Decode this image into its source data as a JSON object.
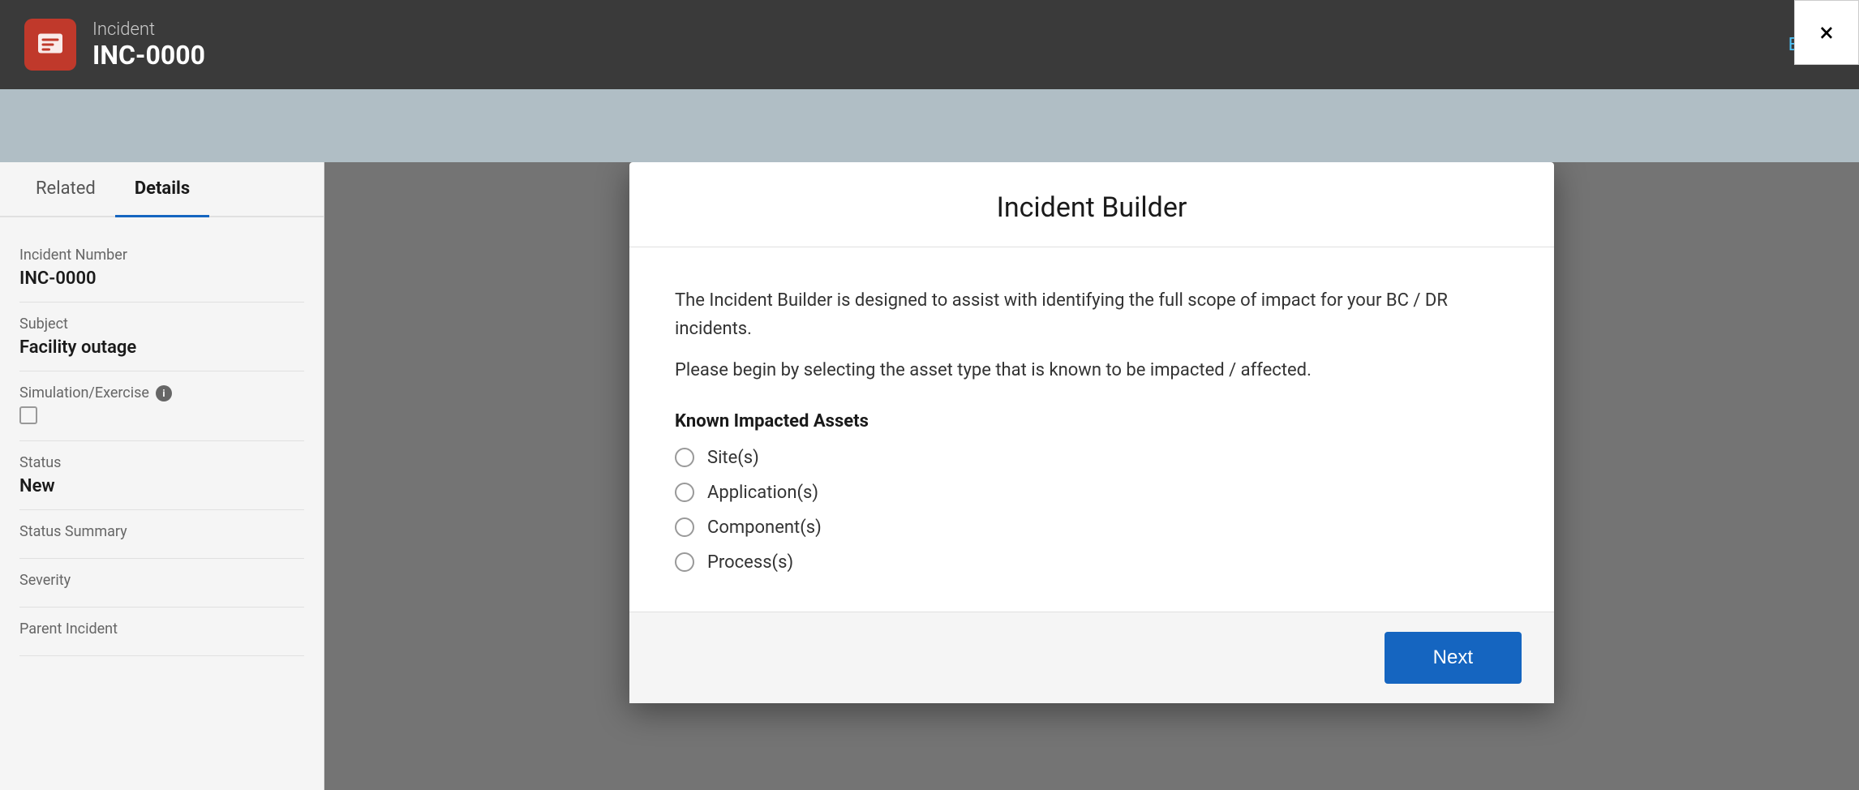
{
  "header": {
    "incident_label": "Incident",
    "incident_number": "INC-0000",
    "edit_label": "Edit"
  },
  "tabs": {
    "related_label": "Related",
    "details_label": "Details"
  },
  "form": {
    "incident_number_label": "Incident Number",
    "incident_number_value": "INC-0000",
    "subject_label": "Subject",
    "subject_value": "Facility outage",
    "simulation_label": "Simulation/Exercise",
    "status_label": "Status",
    "status_value": "New",
    "status_summary_label": "Status Summary",
    "severity_label": "Severity",
    "parent_incident_label": "Parent Incident"
  },
  "modal": {
    "title": "Incident Builder",
    "close_label": "×",
    "description_1": "The Incident Builder is designed to assist with identifying the full scope of impact for your BC / DR incidents.",
    "description_2": "Please begin by selecting the asset type that is known to be impacted / affected.",
    "known_impacted_label": "Known Impacted Assets",
    "radio_options": [
      {
        "id": "sites",
        "label": "Site(s)"
      },
      {
        "id": "applications",
        "label": "Application(s)"
      },
      {
        "id": "components",
        "label": "Component(s)"
      },
      {
        "id": "processes",
        "label": "Process(s)"
      }
    ],
    "next_button_label": "Next"
  }
}
